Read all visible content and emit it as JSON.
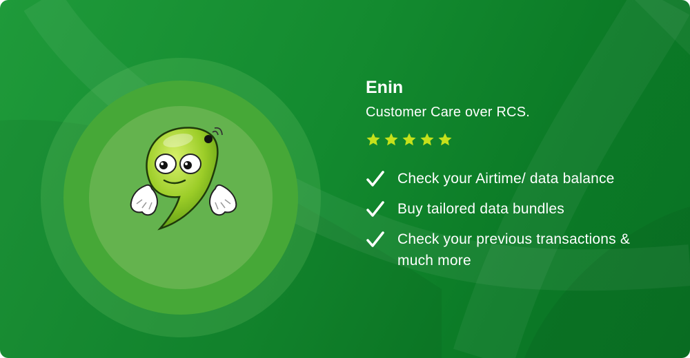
{
  "bot": {
    "name": "Enin",
    "tagline": "Customer Care over RCS.",
    "rating": {
      "value": 5,
      "max": 5
    }
  },
  "features": [
    {
      "text": "Check your Airtime/ data balance",
      "icon": "checkmark-icon"
    },
    {
      "text": "Buy tailored data bundles",
      "icon": "checkmark-icon"
    },
    {
      "text": "Check your previous transactions & much more",
      "icon": "checkmark-icon"
    }
  ],
  "colors": {
    "background": "#138a2f",
    "star": "#c5e11b",
    "mascot": "#8dc21f",
    "text": "#ffffff"
  },
  "icons": {
    "mascot": "mascot-character",
    "star": "star-icon",
    "check": "checkmark-icon"
  }
}
